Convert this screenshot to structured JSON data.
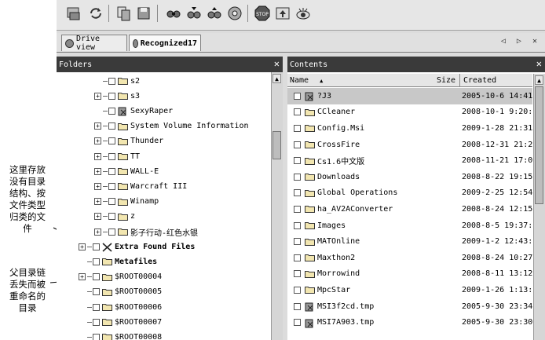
{
  "annotations": {
    "note1": [
      "这里存放",
      "没有目录",
      "结构、按",
      "文件类型",
      "归类的文",
      "件"
    ],
    "note2": [
      "父目录链",
      "丢失而被",
      "重命名的",
      "目录"
    ]
  },
  "tabs": [
    {
      "label": "Drive view",
      "icon": "drive-icon"
    },
    {
      "label": "Recognized17",
      "icon": "drive-icon"
    }
  ],
  "tab_nav": "◁ ▷ ✕",
  "folders_pane": {
    "title": "Folders",
    "close": "✕",
    "items": [
      {
        "label": "s2",
        "expander": "",
        "bold": false,
        "icon": "folder"
      },
      {
        "label": "s3",
        "expander": "+",
        "bold": false,
        "icon": "folder"
      },
      {
        "label": "SexyRaper",
        "expander": "",
        "bold": false,
        "icon": "file"
      },
      {
        "label": "System Volume Information",
        "expander": "+",
        "bold": false,
        "icon": "folder"
      },
      {
        "label": "Thunder",
        "expander": "+",
        "bold": false,
        "icon": "folder"
      },
      {
        "label": "TT",
        "expander": "+",
        "bold": false,
        "icon": "folder"
      },
      {
        "label": "WALL-E",
        "expander": "+",
        "bold": false,
        "icon": "folder"
      },
      {
        "label": "Warcraft III",
        "expander": "+",
        "bold": false,
        "icon": "folder"
      },
      {
        "label": "Winamp",
        "expander": "+",
        "bold": false,
        "icon": "folder"
      },
      {
        "label": "z",
        "expander": "+",
        "bold": false,
        "icon": "folder"
      },
      {
        "label": "影子行动-红色水银",
        "expander": "+",
        "bold": false,
        "icon": "folder"
      },
      {
        "label": "Extra Found Files",
        "expander": "+",
        "bold": true,
        "icon": "extra"
      },
      {
        "label": "Metafiles",
        "expander": "",
        "bold": true,
        "icon": "folder"
      },
      {
        "label": "$ROOT00004",
        "expander": "+",
        "bold": false,
        "icon": "folder"
      },
      {
        "label": "$ROOT00005",
        "expander": "",
        "bold": false,
        "icon": "folder"
      },
      {
        "label": "$ROOT00006",
        "expander": "",
        "bold": false,
        "icon": "folder"
      },
      {
        "label": "$ROOT00007",
        "expander": "",
        "bold": false,
        "icon": "folder"
      },
      {
        "label": "$ROOT00008",
        "expander": "",
        "bold": false,
        "icon": "folder"
      }
    ]
  },
  "contents_pane": {
    "title": "Contents",
    "close": "✕",
    "columns": {
      "name": "Name",
      "size": "Size",
      "created": "Created"
    },
    "rows": [
      {
        "name": "?J3",
        "icon": "file",
        "created": "2005-10-6 14:41",
        "selected": true
      },
      {
        "name": "CCleaner",
        "icon": "folder",
        "created": "2008-10-1 9:20:",
        "selected": false
      },
      {
        "name": "Config.Msi",
        "icon": "folder",
        "created": "2009-1-28 21:31",
        "selected": false
      },
      {
        "name": "CrossFire",
        "icon": "folder",
        "created": "2008-12-31 21:2",
        "selected": false
      },
      {
        "name": "Cs1.6中文版",
        "icon": "folder",
        "created": "2008-11-21 17:0",
        "selected": false
      },
      {
        "name": "Downloads",
        "icon": "folder",
        "created": "2008-8-22 19:15",
        "selected": false
      },
      {
        "name": "Global Operations",
        "icon": "folder",
        "created": "2009-2-25 12:54",
        "selected": false
      },
      {
        "name": "ha_AV2AConverter",
        "icon": "folder",
        "created": "2008-8-24 12:15",
        "selected": false
      },
      {
        "name": "Images",
        "icon": "folder",
        "created": "2008-8-5 19:37:",
        "selected": false
      },
      {
        "name": "MATOnline",
        "icon": "folder",
        "created": "2009-1-2 12:43:",
        "selected": false
      },
      {
        "name": "Maxthon2",
        "icon": "folder",
        "created": "2008-8-24 10:27",
        "selected": false
      },
      {
        "name": "Morrowind",
        "icon": "folder",
        "created": "2008-8-11 13:12",
        "selected": false
      },
      {
        "name": "MpcStar",
        "icon": "folder",
        "created": "2009-1-26 1:13:",
        "selected": false
      },
      {
        "name": "MSI3f2cd.tmp",
        "icon": "file",
        "created": "2005-9-30 23:34",
        "selected": false
      },
      {
        "name": "MSI7A903.tmp",
        "icon": "file",
        "created": "2005-9-30 23:30",
        "selected": false
      }
    ]
  },
  "colors": {
    "pane_header": "#3a3a3a",
    "selection": "#c8c8c8",
    "folder": "#f2e6b0"
  }
}
